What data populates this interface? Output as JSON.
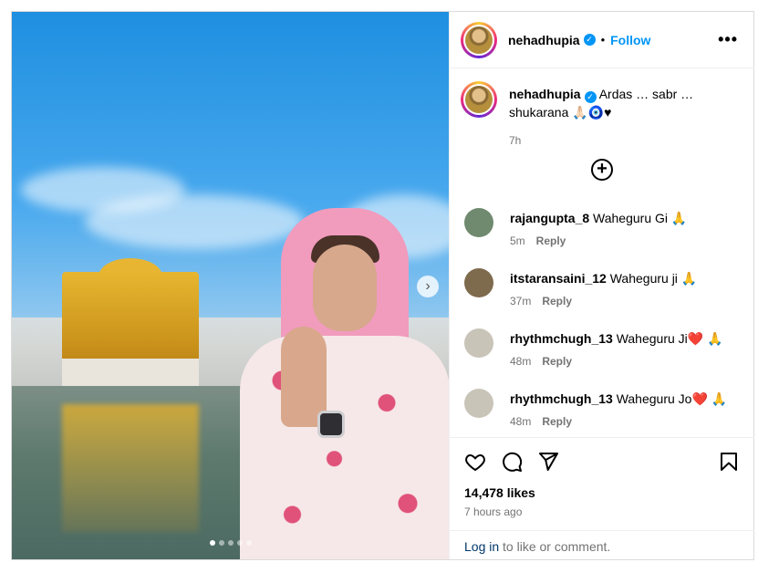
{
  "post": {
    "author": "nehadhupia",
    "separator": "•",
    "follow_label": "Follow",
    "more_label": "•••",
    "caption": "Ardas … sabr … shukarana 🙏🏻🧿♥",
    "caption_time": "7h",
    "carousel": {
      "total": 5,
      "active": 1,
      "next_label": "›"
    },
    "add_comment_label": "+",
    "comments": [
      {
        "user": "rajangupta_8",
        "text": "Waheguru Gi 🙏",
        "time": "5m",
        "reply": "Reply",
        "avatar_color": "#6f8a6e"
      },
      {
        "user": "itstaransaini_12",
        "text": "Waheguru ji 🙏",
        "time": "37m",
        "reply": "Reply",
        "avatar_color": "#7e6a4d"
      },
      {
        "user": "rhythmchugh_13",
        "text": "Waheguru Ji❤️ 🙏",
        "time": "48m",
        "reply": "Reply",
        "avatar_color": "#c9c4b8"
      },
      {
        "user": "rhythmchugh_13",
        "text": "Waheguru Jo❤️ 🙏",
        "time": "48m",
        "reply": "Reply",
        "avatar_color": "#c9c4b8"
      }
    ],
    "likes": "14,478 likes",
    "posted_ago": "7 hours ago",
    "login_link": "Log in",
    "login_suffix": " to like or comment."
  },
  "icons": [
    "heart-icon",
    "comment-icon",
    "share-icon",
    "bookmark-icon",
    "verified-icon",
    "more-icon",
    "add-icon",
    "chevron-right-icon"
  ],
  "colors": {
    "accent": "#0095f6",
    "muted": "#737373",
    "border": "#dbdbdb"
  }
}
